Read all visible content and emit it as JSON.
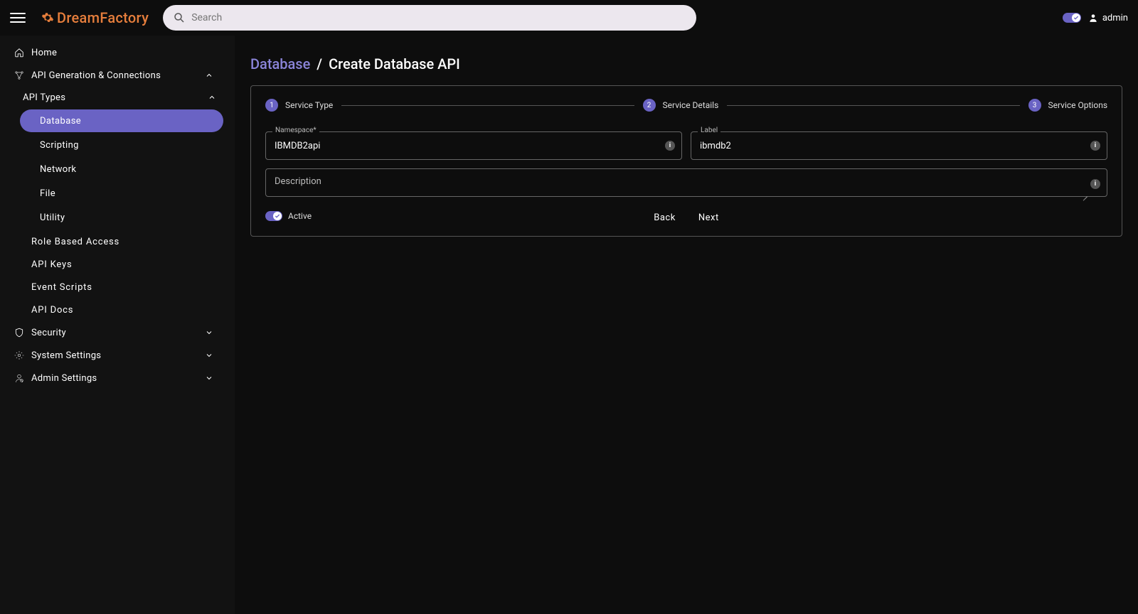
{
  "header": {
    "logo_text": "DreamFactory",
    "search_placeholder": "Search",
    "admin_label": "admin"
  },
  "sidebar": {
    "home": "Home",
    "api_gen": "API Generation & Connections",
    "api_types_header": "API Types",
    "api_types": {
      "database": "Database",
      "scripting": "Scripting",
      "network": "Network",
      "file": "File",
      "utility": "Utility"
    },
    "rba": "Role Based Access",
    "api_keys": "API Keys",
    "event_scripts": "Event Scripts",
    "api_docs": "API Docs",
    "security": "Security",
    "system_settings": "System Settings",
    "admin_settings": "Admin Settings"
  },
  "breadcrumb": {
    "link": "Database",
    "sep": "/",
    "current": "Create Database API"
  },
  "stepper": {
    "s1_num": "1",
    "s1_label": "Service Type",
    "s2_num": "2",
    "s2_label": "Service Details",
    "s3_num": "3",
    "s3_label": "Service Options"
  },
  "form": {
    "namespace_label": "Namespace*",
    "namespace_value": "IBMDB2api",
    "label_label": "Label",
    "label_value": "ibmdb2",
    "description_placeholder": "Description",
    "description_value": "",
    "active_label": "Active",
    "back": "Back",
    "next": "Next"
  }
}
